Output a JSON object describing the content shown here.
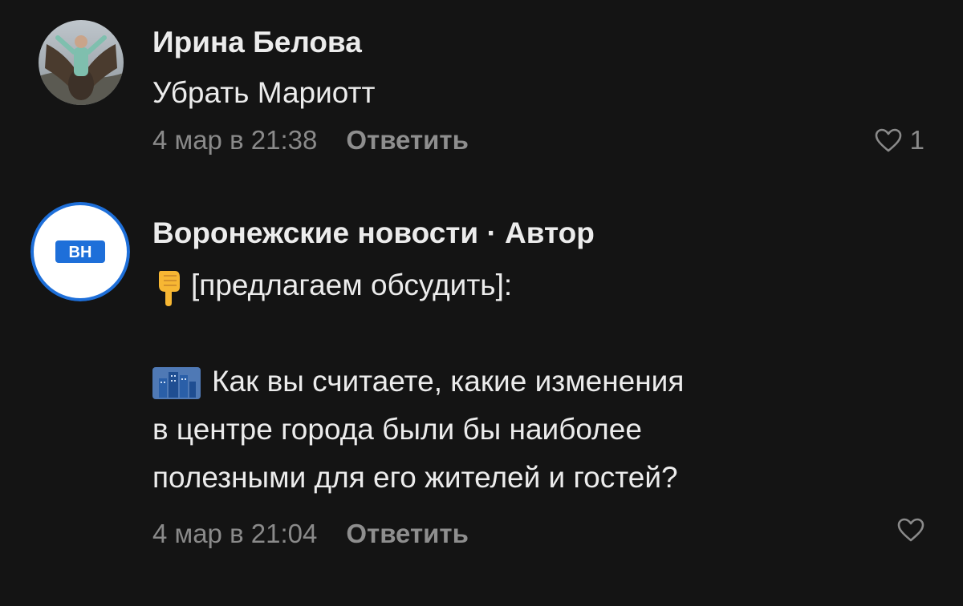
{
  "comments": [
    {
      "author": "Ирина Белова",
      "text": "Убрать Мариотт",
      "timestamp": "4 мар в 21:38",
      "reply_label": "Ответить",
      "like_count": "1",
      "avatar_icon": "user-photo-avatar"
    },
    {
      "author": "Воронежские новости · Автор",
      "avatar_label": "ВН",
      "lines": [
        "[предлагаем обсудить]:",
        "",
        "Как вы считаете, какие изменения",
        "в центре города были бы наиболее",
        "полезными для его жителей и гостей?"
      ],
      "timestamp": "4 мар в 21:04",
      "reply_label": "Ответить",
      "like_icon": "heart-outline-icon",
      "brand_color": "#1e6fd9"
    }
  ]
}
